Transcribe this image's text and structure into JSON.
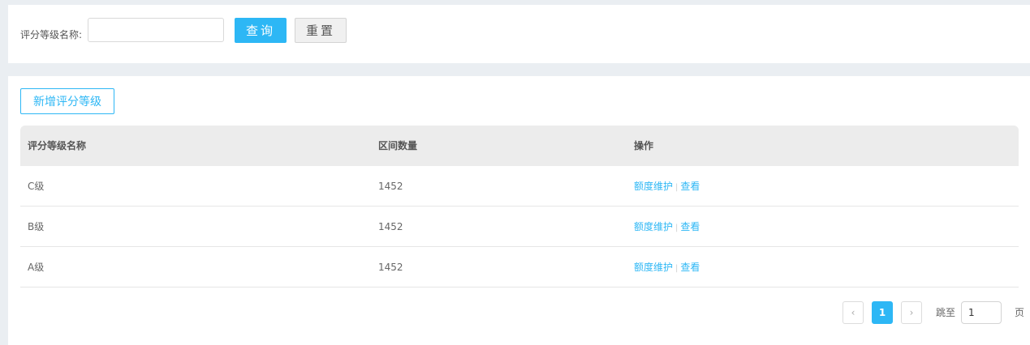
{
  "search": {
    "label": "评分等级名称:",
    "input_value": "",
    "query_button": "查询",
    "reset_button": "重置"
  },
  "toolbar": {
    "add_button": "新增评分等级"
  },
  "table": {
    "headers": [
      "评分等级名称",
      "区间数量",
      "操作"
    ],
    "rows": [
      {
        "name": "C级",
        "count": "1452",
        "op1": "额度维护",
        "op2": "查看"
      },
      {
        "name": "B级",
        "count": "1452",
        "op1": "额度维护",
        "op2": "查看"
      },
      {
        "name": "A级",
        "count": "1452",
        "op1": "额度维护",
        "op2": "查看"
      }
    ],
    "separator": "|"
  },
  "pagination": {
    "prev_icon": "chevron-left-icon",
    "prev_symbol": "‹",
    "current_page": "1",
    "next_icon": "chevron-right-icon",
    "next_symbol": "›",
    "jump_label": "跳至",
    "jump_value": "1",
    "page_unit": "页"
  },
  "colors": {
    "accent": "#2db7f5",
    "page_background": "#eaeef2",
    "header_background": "#ececec"
  }
}
